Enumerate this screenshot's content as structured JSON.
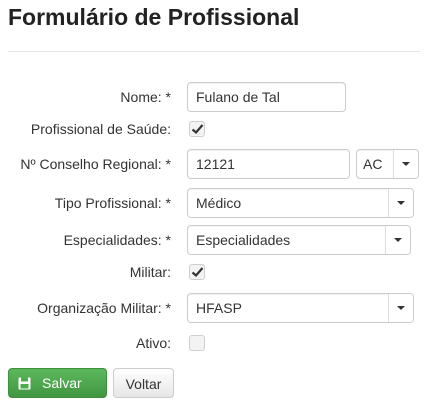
{
  "page": {
    "title": "Formulário de Profissional"
  },
  "form": {
    "nome": {
      "label": "Nome: *",
      "value": "Fulano de Tal"
    },
    "profissional_saude": {
      "label": "Profissional de Saúde:",
      "checked": true
    },
    "conselho": {
      "label": "Nº Conselho Regional: *",
      "value": "12121",
      "uf": "AC"
    },
    "tipo": {
      "label": "Tipo Profissional: *",
      "value": "Médico"
    },
    "especialidades": {
      "label": "Especialidades: *",
      "value": "Especialidades"
    },
    "militar": {
      "label": "Militar:",
      "checked": true
    },
    "organizacao": {
      "label": "Organização Militar: *",
      "value": "HFASP"
    },
    "ativo": {
      "label": "Ativo:",
      "checked": false
    }
  },
  "buttons": {
    "save_label": "Salvar",
    "back_label": "Voltar",
    "save_icon": "floppy-disk-icon"
  },
  "colors": {
    "save_bg": "#5cb85c",
    "check_mark": "#333333"
  }
}
